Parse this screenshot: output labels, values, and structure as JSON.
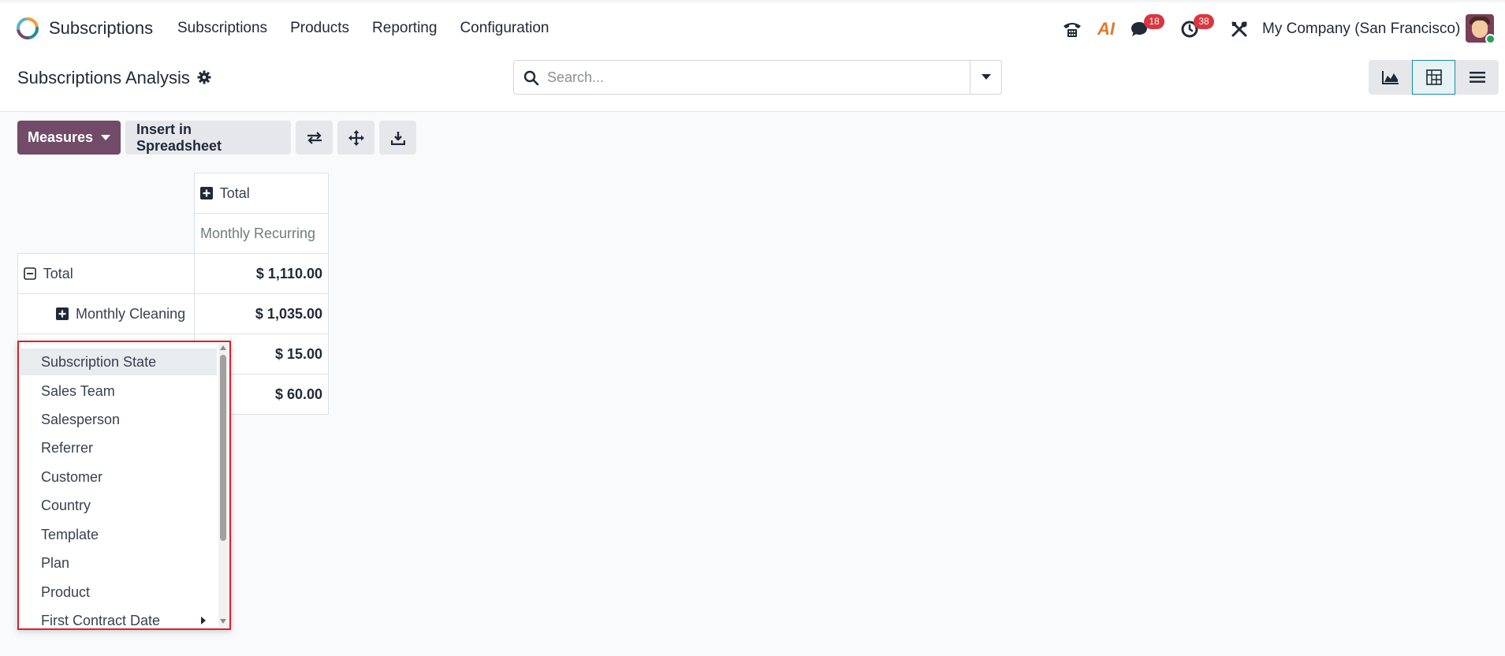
{
  "navbar": {
    "app_name": "Subscriptions",
    "menu": [
      "Subscriptions",
      "Products",
      "Reporting",
      "Configuration"
    ],
    "badges": {
      "messages": "18",
      "activities": "38"
    },
    "ai_label": "AI",
    "company": "My Company (San Francisco)",
    "icons": [
      "phone-icon",
      "ai-icon",
      "chat-icon",
      "clock-icon",
      "tools-icon"
    ]
  },
  "control_panel": {
    "title": "Subscriptions Analysis",
    "search_placeholder": "Search...",
    "views": [
      "graph",
      "pivot",
      "list"
    ],
    "active_view": "pivot"
  },
  "toolbar": {
    "measures_label": "Measures",
    "insert_label": "Insert in Spreadsheet"
  },
  "pivot": {
    "col_header": "Total",
    "measure": "Monthly Recurring",
    "rows": [
      {
        "label": "Total",
        "value": "$ 1,110.00",
        "expanded": true
      },
      {
        "label": "Monthly Cleaning",
        "value": "$ 1,035.00",
        "expanded": false
      },
      {
        "label": "",
        "value": "$ 15.00"
      },
      {
        "label": "",
        "value": "$ 60.00"
      }
    ]
  },
  "groupby_dropdown": {
    "items": [
      "Subscription State",
      "Sales Team",
      "Salesperson",
      "Referrer",
      "Customer",
      "Country",
      "Template",
      "Plan",
      "Product",
      "First Contract Date"
    ],
    "highlighted": "Subscription State",
    "submenu_item": "First Contract Date"
  },
  "colors": {
    "brand": "#714b67",
    "badge": "#d9363e",
    "active_view_border": "#1e8b9b",
    "dropdown_border": "#e11d2a"
  }
}
